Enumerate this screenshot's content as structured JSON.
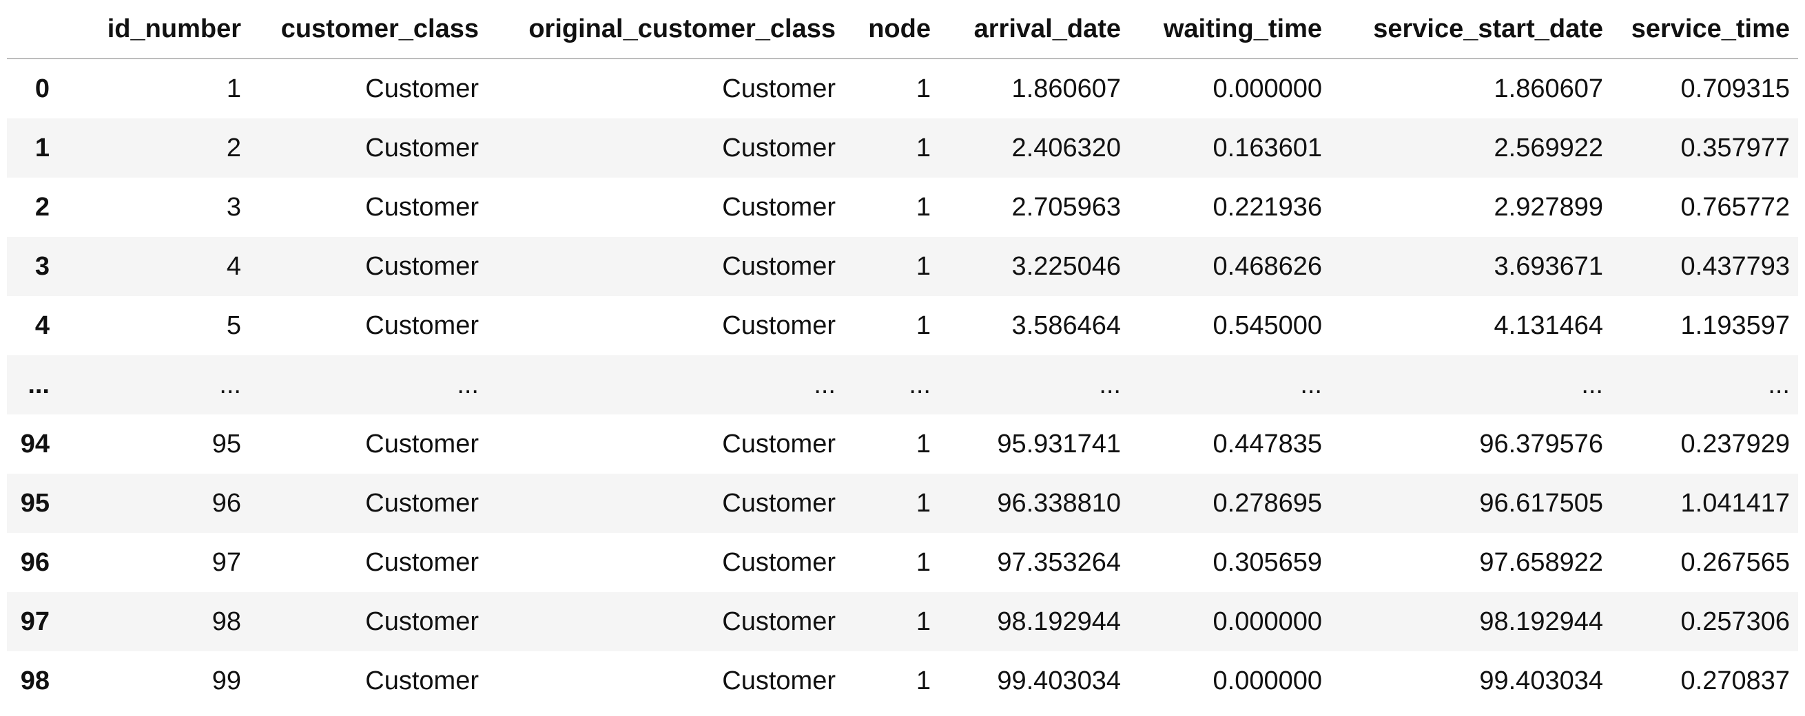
{
  "table": {
    "index_header": "",
    "columns": [
      "id_number",
      "customer_class",
      "original_customer_class",
      "node",
      "arrival_date",
      "waiting_time",
      "service_start_date",
      "service_time"
    ],
    "rows": [
      {
        "index": "0",
        "cells": [
          "1",
          "Customer",
          "Customer",
          "1",
          "1.860607",
          "0.000000",
          "1.860607",
          "0.709315"
        ]
      },
      {
        "index": "1",
        "cells": [
          "2",
          "Customer",
          "Customer",
          "1",
          "2.406320",
          "0.163601",
          "2.569922",
          "0.357977"
        ]
      },
      {
        "index": "2",
        "cells": [
          "3",
          "Customer",
          "Customer",
          "1",
          "2.705963",
          "0.221936",
          "2.927899",
          "0.765772"
        ]
      },
      {
        "index": "3",
        "cells": [
          "4",
          "Customer",
          "Customer",
          "1",
          "3.225046",
          "0.468626",
          "3.693671",
          "0.437793"
        ]
      },
      {
        "index": "4",
        "cells": [
          "5",
          "Customer",
          "Customer",
          "1",
          "3.586464",
          "0.545000",
          "4.131464",
          "1.193597"
        ]
      },
      {
        "index": "...",
        "cells": [
          "...",
          "...",
          "...",
          "...",
          "...",
          "...",
          "...",
          "..."
        ]
      },
      {
        "index": "94",
        "cells": [
          "95",
          "Customer",
          "Customer",
          "1",
          "95.931741",
          "0.447835",
          "96.379576",
          "0.237929"
        ]
      },
      {
        "index": "95",
        "cells": [
          "96",
          "Customer",
          "Customer",
          "1",
          "96.338810",
          "0.278695",
          "96.617505",
          "1.041417"
        ]
      },
      {
        "index": "96",
        "cells": [
          "97",
          "Customer",
          "Customer",
          "1",
          "97.353264",
          "0.305659",
          "97.658922",
          "0.267565"
        ]
      },
      {
        "index": "97",
        "cells": [
          "98",
          "Customer",
          "Customer",
          "1",
          "98.192944",
          "0.000000",
          "98.192944",
          "0.257306"
        ]
      },
      {
        "index": "98",
        "cells": [
          "99",
          "Customer",
          "Customer",
          "1",
          "99.403034",
          "0.000000",
          "99.403034",
          "0.270837"
        ]
      }
    ]
  }
}
